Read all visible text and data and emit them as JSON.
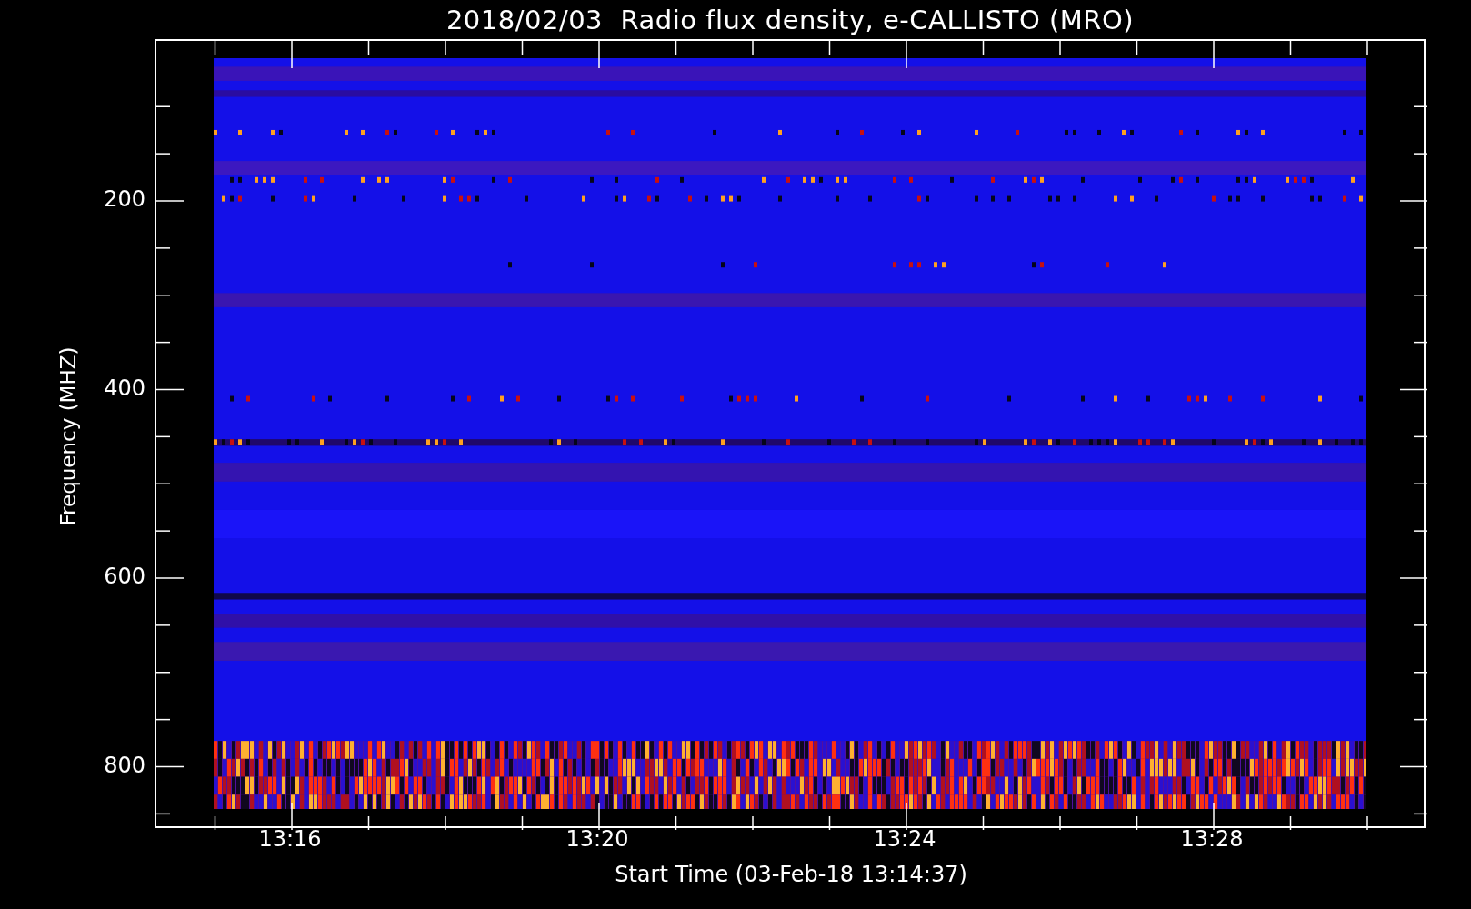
{
  "title": "2018/02/03  Radio flux density, e-CALLISTO (MRO)",
  "plot": {
    "ylabel": "Frequency (MHZ)",
    "xlabel": "Start Time (03-Feb-18 13:14:37)",
    "yticks": [
      "200",
      "400",
      "600",
      "800"
    ],
    "xticks": [
      "13:16",
      "13:20",
      "13:24",
      "13:28"
    ]
  }
}
